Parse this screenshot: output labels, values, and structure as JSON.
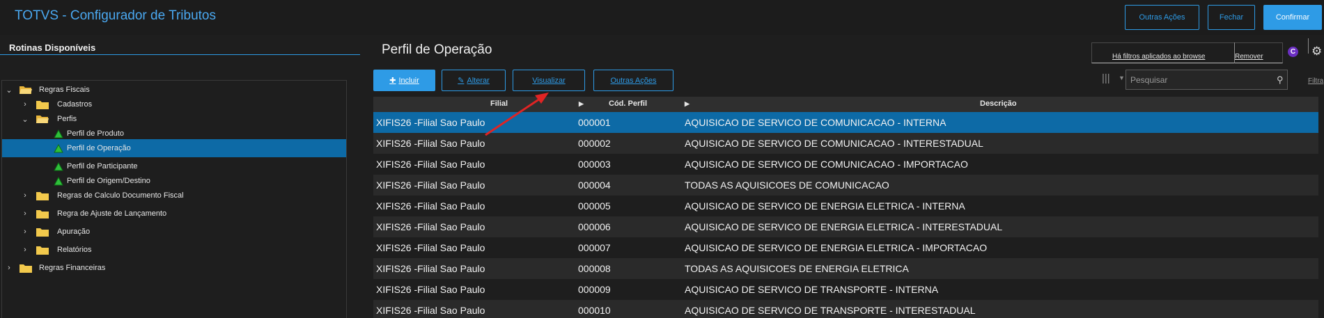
{
  "header": {
    "app_title": "TOTVS - Configurador de Tributos",
    "buttons": {
      "outras_acoes": "Outras Ações",
      "fechar": "Fechar",
      "confirmar": "Confirmar"
    }
  },
  "left_panel": {
    "title": "Rotinas Disponíveis",
    "tree": [
      {
        "label": "Regras Fiscais",
        "expanded": true,
        "icon": "folder-open-icon"
      },
      {
        "label": "Cadastros",
        "expanded": false,
        "icon": "folder-icon"
      },
      {
        "label": "Perfis",
        "expanded": true,
        "icon": "folder-open-icon"
      },
      {
        "label": "Perfil de Produto",
        "icon": "green-triangle-icon"
      },
      {
        "label": "Perfil de Operação",
        "icon": "green-triangle-icon",
        "selected": true
      },
      {
        "label": "Perfil de Participante",
        "icon": "green-triangle-icon"
      },
      {
        "label": "Perfil de Origem/Destino",
        "icon": "green-triangle-icon"
      },
      {
        "label": "Regras de Calculo Documento Fiscal",
        "expanded": false,
        "icon": "folder-icon"
      },
      {
        "label": "Regra de Ajuste de Lançamento",
        "expanded": false,
        "icon": "folder-icon"
      },
      {
        "label": "Apuração",
        "expanded": false,
        "icon": "folder-icon"
      },
      {
        "label": "Relatórios",
        "expanded": false,
        "icon": "folder-icon"
      },
      {
        "label": "Regras Financeiras",
        "expanded": false,
        "icon": "folder-icon"
      }
    ]
  },
  "main": {
    "title": "Perfil de Operação",
    "filter_notice": "Há filtros aplicados ao browse",
    "filter_remove": "Remover",
    "c_badge": "C",
    "toolbar": {
      "incluir": "Incluir",
      "alterar": "Alterar",
      "visualizar": "Visualizar",
      "outras_acoes": "Outras Ações"
    },
    "search": {
      "placeholder": "Pesquisar"
    },
    "filtrar_label": "Filtra",
    "grid": {
      "columns": [
        "Filial",
        "Cód. Perfil",
        "Descrição"
      ],
      "rows": [
        [
          "XIFIS26 -Filial Sao Paulo",
          "000001",
          "AQUISICAO DE SERVICO DE COMUNICACAO - INTERNA"
        ],
        [
          "XIFIS26 -Filial Sao Paulo",
          "000002",
          "AQUISICAO DE SERVICO DE COMUNICACAO - INTERESTADUAL"
        ],
        [
          "XIFIS26 -Filial Sao Paulo",
          "000003",
          "AQUISICAO DE SERVICO DE COMUNICACAO - IMPORTACAO"
        ],
        [
          "XIFIS26 -Filial Sao Paulo",
          "000004",
          "TODAS AS AQUISICOES DE COMUNICACAO"
        ],
        [
          "XIFIS26 -Filial Sao Paulo",
          "000005",
          "AQUISICAO DE SERVICO DE ENERGIA ELETRICA - INTERNA"
        ],
        [
          "XIFIS26 -Filial Sao Paulo",
          "000006",
          "AQUISICAO DE SERVICO DE ENERGIA ELETRICA - INTERESTADUAL"
        ],
        [
          "XIFIS26 -Filial Sao Paulo",
          "000007",
          "AQUISICAO DE SERVICO DE ENERGIA ELETRICA - IMPORTACAO"
        ],
        [
          "XIFIS26 -Filial Sao Paulo",
          "000008",
          "TODAS AS AQUISICOES DE ENERGIA ELETRICA"
        ],
        [
          "XIFIS26 -Filial Sao Paulo",
          "000009",
          "AQUISICAO DE SERVICO DE TRANSPORTE - INTERNA"
        ],
        [
          "XIFIS26 -Filial Sao Paulo",
          "000010",
          "AQUISICAO DE SERVICO DE TRANSPORTE - INTERESTADUAL"
        ]
      ]
    }
  },
  "colors": {
    "accent": "#2e9be6",
    "selected_row": "#0d6aa6",
    "annotation_arrow": "#e02424"
  }
}
